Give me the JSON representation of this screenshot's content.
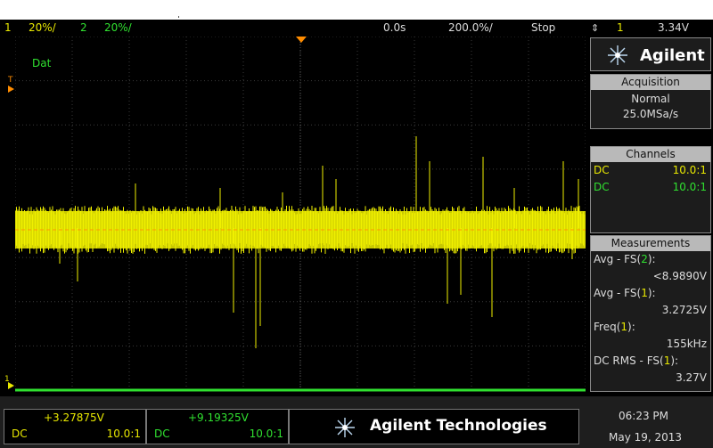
{
  "top_bar": {
    "ch1_num": "1",
    "ch1_scale": "20%/",
    "ch2_num": "2",
    "ch2_scale": "20%/",
    "time_offset": "0.0s",
    "time_scale": "200.0%/",
    "run_state": "Stop",
    "trigger_source": "1",
    "trigger_level": "3.34V"
  },
  "screen": {
    "label": "Dat",
    "trigger_marker": "T",
    "ground_marker": "1"
  },
  "panel": {
    "brand": "Agilent",
    "acquisition": {
      "title": "Acquisition",
      "mode": "Normal",
      "rate": "25.0MSa/s"
    },
    "channels": {
      "title": "Channels",
      "rows": [
        {
          "coupling": "DC",
          "probe": "10.0:1",
          "color": "#e8e800"
        },
        {
          "coupling": "DC",
          "probe": "10.0:1",
          "color": "#30e030"
        }
      ]
    },
    "measurements": {
      "title": "Measurements",
      "items": [
        {
          "name": "Avg - FS(",
          "chan": "2",
          "tail": "):",
          "value": "<8.9890V",
          "chan_color": "#30e030"
        },
        {
          "name": "Avg - FS(",
          "chan": "1",
          "tail": "):",
          "value": "3.2725V",
          "chan_color": "#e8e800"
        },
        {
          "name": "Freq(",
          "chan": "1",
          "tail": "):",
          "value": "155kHz",
          "chan_color": "#e8e800"
        },
        {
          "name": "DC RMS - FS(",
          "chan": "1",
          "tail": "):",
          "value": "3.27V",
          "chan_color": "#e8e800"
        }
      ]
    }
  },
  "bottom": {
    "ch1_value": "+3.27875V",
    "ch1_coupling": "DC",
    "ch1_probe": "10.0:1",
    "ch2_value": "+9.19325V",
    "ch2_coupling": "DC",
    "ch2_probe": "10.0:1",
    "brand": "Agilent Technologies",
    "time": "06:23 PM",
    "date": "May 19, 2013"
  },
  "colors": {
    "ch1": "#e8e800",
    "ch2": "#30e030"
  }
}
